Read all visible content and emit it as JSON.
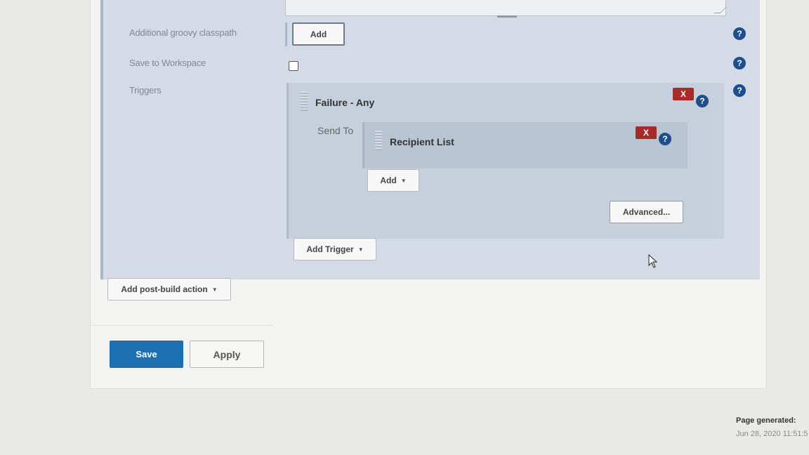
{
  "config": {
    "groovy_classpath": {
      "label": "Additional groovy classpath",
      "add_button": "Add"
    },
    "save_workspace": {
      "label": "Save to Workspace",
      "checked": false
    },
    "triggers": {
      "label": "Triggers",
      "trigger": {
        "title": "Failure - Any",
        "delete_label": "X",
        "send_to_label": "Send To",
        "recipient": {
          "title": "Recipient List",
          "delete_label": "X"
        },
        "add_button": "Add",
        "advanced_button": "Advanced..."
      },
      "add_trigger_button": "Add Trigger"
    },
    "help_glyph": "?"
  },
  "post_build": {
    "add_action_button": "Add post-build action"
  },
  "buttons": {
    "save": "Save",
    "apply": "Apply"
  },
  "footer": {
    "label": "Page generated:",
    "value": "Jun 28, 2020 11:51:5"
  },
  "colors": {
    "primary": "#1d6fb0",
    "danger": "#a82a2a",
    "help": "#1f4e8f"
  },
  "icons": [
    "help-icon",
    "delete-icon",
    "chevron-down-icon",
    "mouse-pointer-icon",
    "drag-handle-icon"
  ]
}
